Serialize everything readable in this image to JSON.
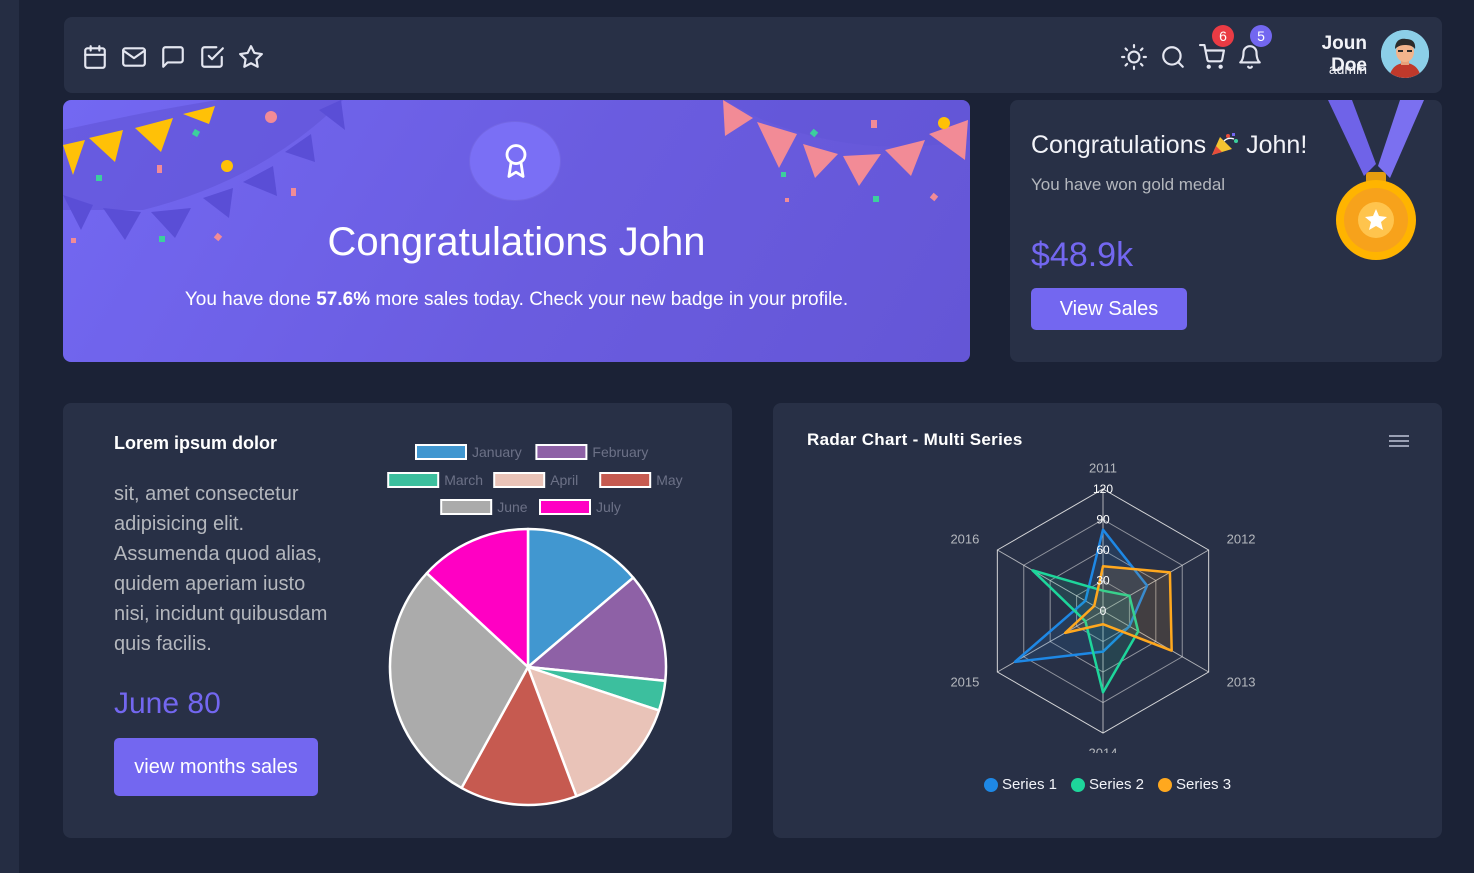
{
  "topbar": {
    "icons": [
      "calendar-icon",
      "mail-icon",
      "chat-icon",
      "checkbox-icon",
      "star-icon",
      "sun-icon",
      "search-icon",
      "cart-icon",
      "bell-icon"
    ],
    "cart_badge": "6",
    "bell_badge": "5",
    "user_name": "Joun Doe",
    "user_role": "admin"
  },
  "banner": {
    "title": "Congratulations John",
    "text_before": "You have done ",
    "text_highlight": "57.6%",
    "text_after": " more sales today. Check your new badge in your profile."
  },
  "medal_card": {
    "title_start": "Congratulations",
    "title_end": "John!",
    "subtitle": "You have won gold medal",
    "amount": "$48.9k",
    "button_label": "View Sales"
  },
  "pie_card": {
    "heading": "Lorem ipsum dolor",
    "body": "sit, amet consectetur adipisicing elit. Assumenda quod alias, quidem aperiam iusto nisi, incidunt quibusdam quis facilis.",
    "highlight": "June 80",
    "button_label": "view months sales"
  },
  "radar_card": {
    "title": "Radar Chart - Multi Series",
    "legend": [
      "Series 1",
      "Series 2",
      "Series 3"
    ]
  },
  "colors": {
    "background": "#1b2236",
    "card": "#283046",
    "primary": "#7367f0",
    "badge_red": "#ea3b44",
    "series1": "#1e88e5",
    "series2": "#1ed69b",
    "series3": "#ffa81e"
  },
  "chart_data": [
    {
      "type": "pie",
      "legend_position": "top",
      "categories": [
        "January",
        "February",
        "March",
        "April",
        "May",
        "June",
        "July"
      ],
      "values": [
        13.8,
        12.8,
        3.5,
        14.2,
        13.7,
        28.9,
        13.1
      ],
      "colors": [
        "#4197d0",
        "#8e61a6",
        "#3cbf9e",
        "#e9c3b8",
        "#c65a50",
        "#ababab",
        "#ff00c3"
      ]
    },
    {
      "type": "radar",
      "title": "Radar Chart - Multi Series",
      "categories": [
        "2011",
        "2012",
        "2013",
        "2014",
        "2015",
        "2016"
      ],
      "ylim": [
        0,
        120
      ],
      "ticks": [
        "0",
        "30",
        "60",
        "90",
        "120"
      ],
      "legend_position": "bottom",
      "series": [
        {
          "name": "Series 1",
          "values": [
            80,
            50,
            30,
            40,
            100,
            20
          ]
        },
        {
          "name": "Series 2",
          "values": [
            20,
            30,
            40,
            80,
            20,
            80
          ]
        },
        {
          "name": "Series 3",
          "values": [
            44,
            76,
            78,
            13,
            43,
            10
          ]
        }
      ]
    }
  ]
}
